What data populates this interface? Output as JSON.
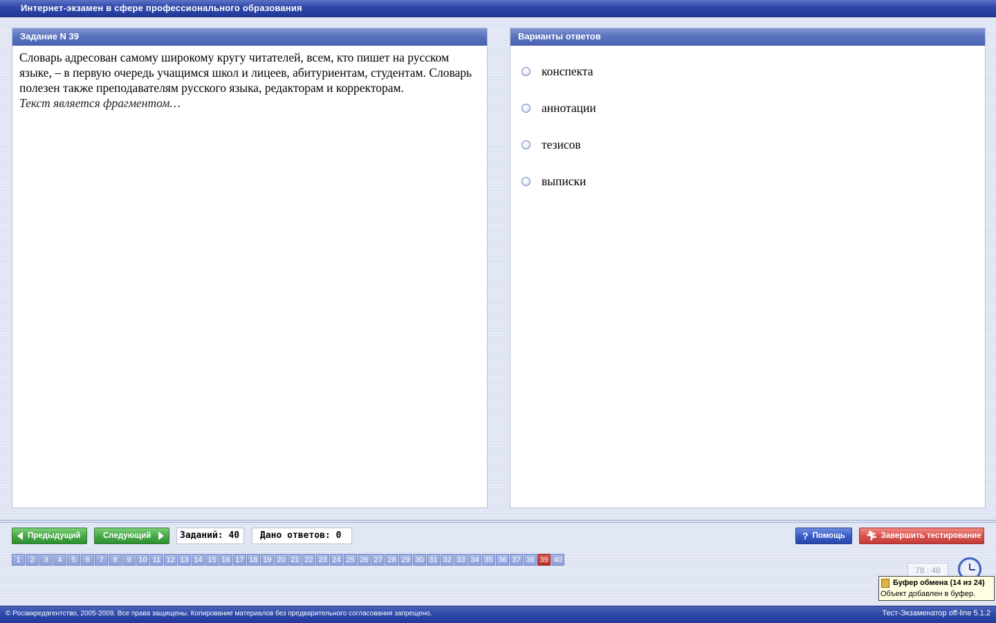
{
  "window": {
    "title": "Интернет-экзамен в сфере профессионального образования"
  },
  "task": {
    "header": "Задание N 39",
    "text": "Словарь адресован самому широкому кругу читателей, всем, кто пишет на русском языке, – в первую очередь учащимся школ и лицеев, абитуриентам, студентам. Словарь полезен также преподавателям русского языка, редакторам и корректорам.",
    "hint": "Текст является фрагментом…"
  },
  "answers": {
    "header": "Варианты ответов",
    "options": [
      {
        "label": "конспекта"
      },
      {
        "label": "аннотации"
      },
      {
        "label": "тезисов"
      },
      {
        "label": "выписки"
      }
    ]
  },
  "nav": {
    "prev_label": "Предыдущий",
    "next_label": "Следующий",
    "tasks_count": "Заданий: 40",
    "answers_given": "Дано ответов: 0",
    "help_label": "Помощь",
    "finish_label": "Завершить тестирование"
  },
  "pager": {
    "pages": [
      "1",
      "2",
      "3",
      "4",
      "5",
      "6",
      "7",
      "8",
      "9",
      "10",
      "11",
      "12",
      "13",
      "14",
      "15",
      "16",
      "17",
      "18",
      "19",
      "20",
      "21",
      "22",
      "23",
      "24",
      "25",
      "26",
      "27",
      "28",
      "29",
      "30",
      "31",
      "32",
      "33",
      "34",
      "35",
      "36",
      "37",
      "38",
      "39",
      "40"
    ],
    "current": "39"
  },
  "timer": {
    "value": "78 : 48"
  },
  "tooltip": {
    "title": "Буфер обмена (14 из 24)",
    "body": "Объект добавлен в буфер."
  },
  "footer": {
    "copyright": "© Росаккредагентство, 2005-2009. Все права защищены. Копирование материалов без предварительного согласования запрещено.",
    "version": "Тест-Экзаменатор off-line 5.1.2"
  },
  "colors": {
    "title_bar": "#2d47a8",
    "panel_header": "#5a72bd",
    "button_green": "#46a947",
    "button_blue": "#3a5cc8",
    "button_red": "#d9534f",
    "page_active": "#c23c38"
  }
}
